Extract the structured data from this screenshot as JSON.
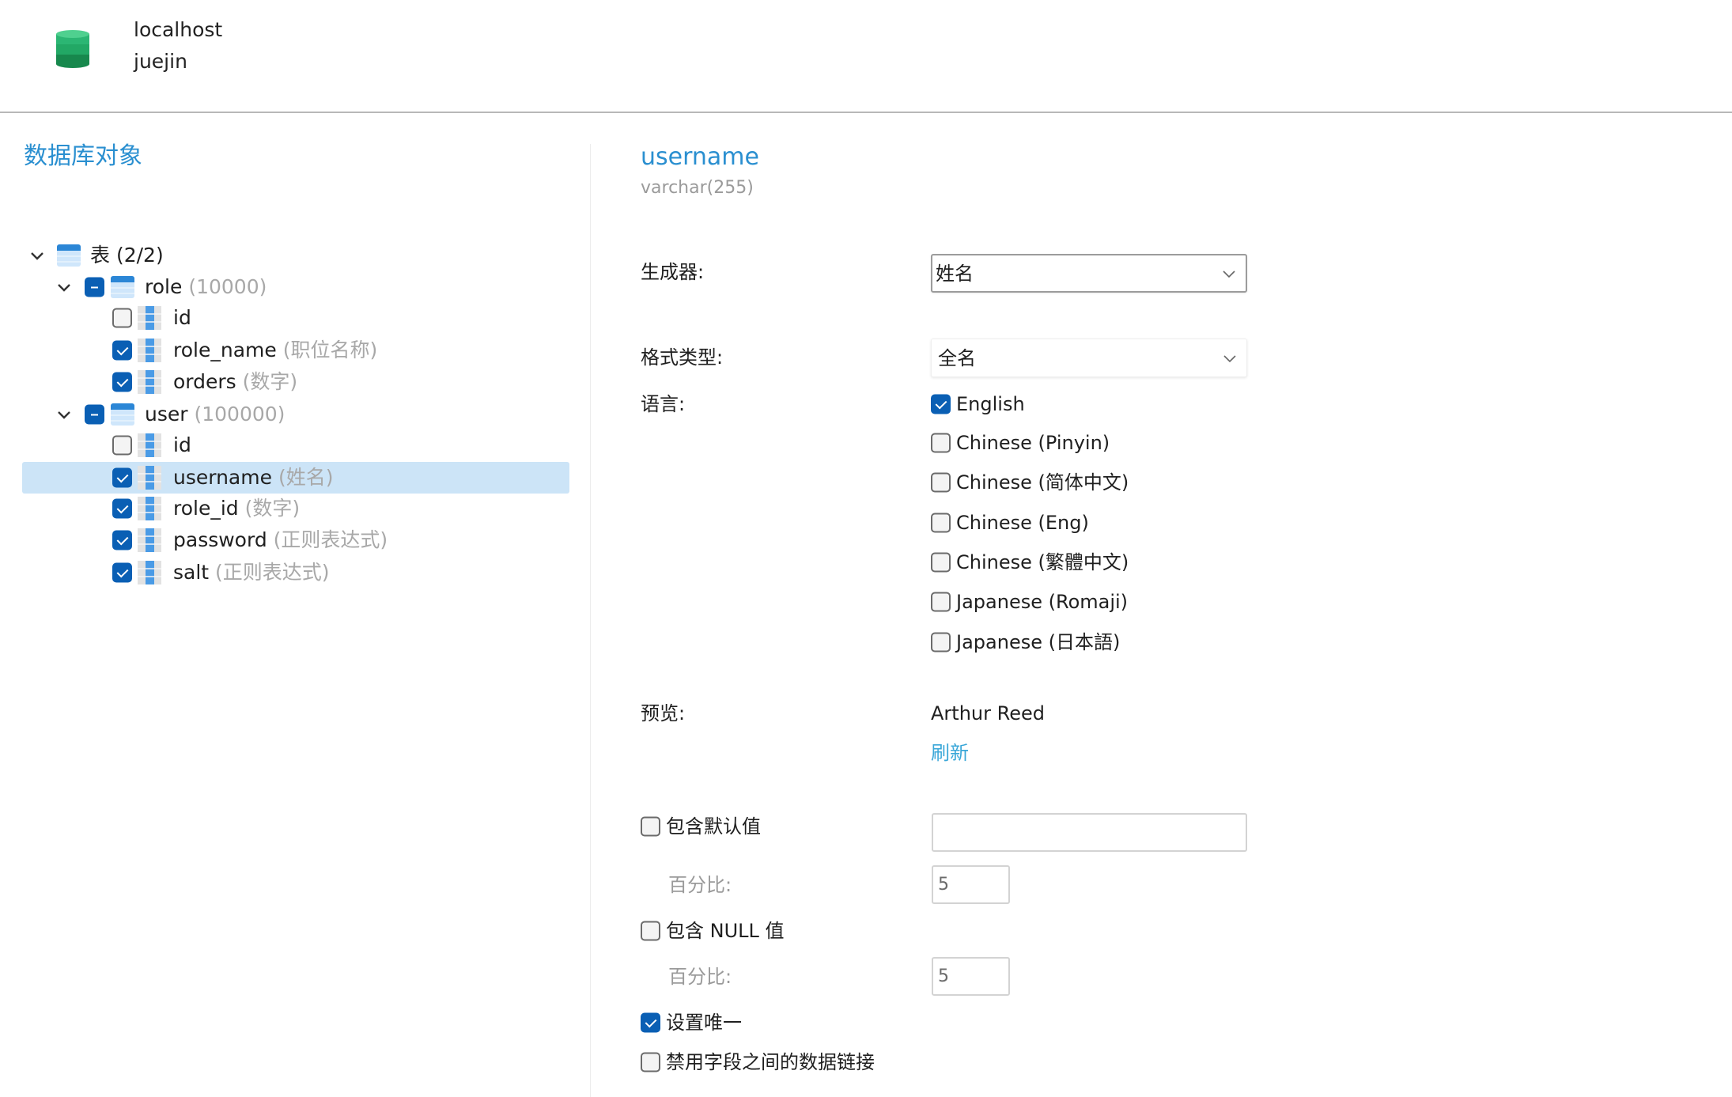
{
  "header": {
    "icon": "database-icon",
    "host": "localhost",
    "database": "juejin"
  },
  "left_pane": {
    "title": "数据库对象",
    "tree": {
      "root": {
        "label": "表",
        "count": "(2/2)",
        "expanded": true,
        "icon": "table-group-icon"
      },
      "tables": [
        {
          "name": "role",
          "rows": "(10000)",
          "expanded": true,
          "check_state": "partial",
          "columns": [
            {
              "name": "id",
              "generator": "",
              "checked": false
            },
            {
              "name": "role_name",
              "generator": "(职位名称)",
              "checked": true
            },
            {
              "name": "orders",
              "generator": "(数字)",
              "checked": true
            }
          ]
        },
        {
          "name": "user",
          "rows": "(100000)",
          "expanded": true,
          "check_state": "partial",
          "columns": [
            {
              "name": "id",
              "generator": "",
              "checked": false
            },
            {
              "name": "username",
              "generator": "(姓名)",
              "checked": true,
              "selected": true
            },
            {
              "name": "role_id",
              "generator": "(数字)",
              "checked": true
            },
            {
              "name": "password",
              "generator": "(正则表达式)",
              "checked": true
            },
            {
              "name": "salt",
              "generator": "(正则表达式)",
              "checked": true
            }
          ]
        }
      ]
    }
  },
  "detail": {
    "field_name": "username",
    "field_type": "varchar(255)",
    "generator": {
      "label": "生成器:",
      "value": "姓名"
    },
    "format_type": {
      "label": "格式类型:",
      "value": "全名"
    },
    "language": {
      "label": "语言:",
      "options": [
        {
          "label": "English",
          "checked": true
        },
        {
          "label": "Chinese (Pinyin)",
          "checked": false
        },
        {
          "label": "Chinese (简体中文)",
          "checked": false
        },
        {
          "label": "Chinese (Eng)",
          "checked": false
        },
        {
          "label": "Chinese (繁體中文)",
          "checked": false
        },
        {
          "label": "Japanese (Romaji)",
          "checked": false
        },
        {
          "label": "Japanese (日本語)",
          "checked": false
        }
      ]
    },
    "preview": {
      "label": "预览:",
      "value": "Arthur Reed",
      "refresh_label": "刷新"
    },
    "include_default": {
      "label": "包含默认值",
      "checked": false,
      "value": ""
    },
    "default_percent": {
      "label": "百分比:",
      "value": "5"
    },
    "include_null": {
      "label": "包含 NULL 值",
      "checked": false
    },
    "null_percent": {
      "label": "百分比:",
      "value": "5"
    },
    "unique": {
      "label": "设置唯一",
      "checked": true
    },
    "disable_link": {
      "label": "禁用字段之间的数据链接",
      "checked": false
    }
  },
  "colors": {
    "accent": "#2a8fd0",
    "checkbox_checked": "#0a5fb4",
    "selection": "#cce4f7",
    "link": "#3aa7d8",
    "muted_text": "#a8a8a8"
  }
}
